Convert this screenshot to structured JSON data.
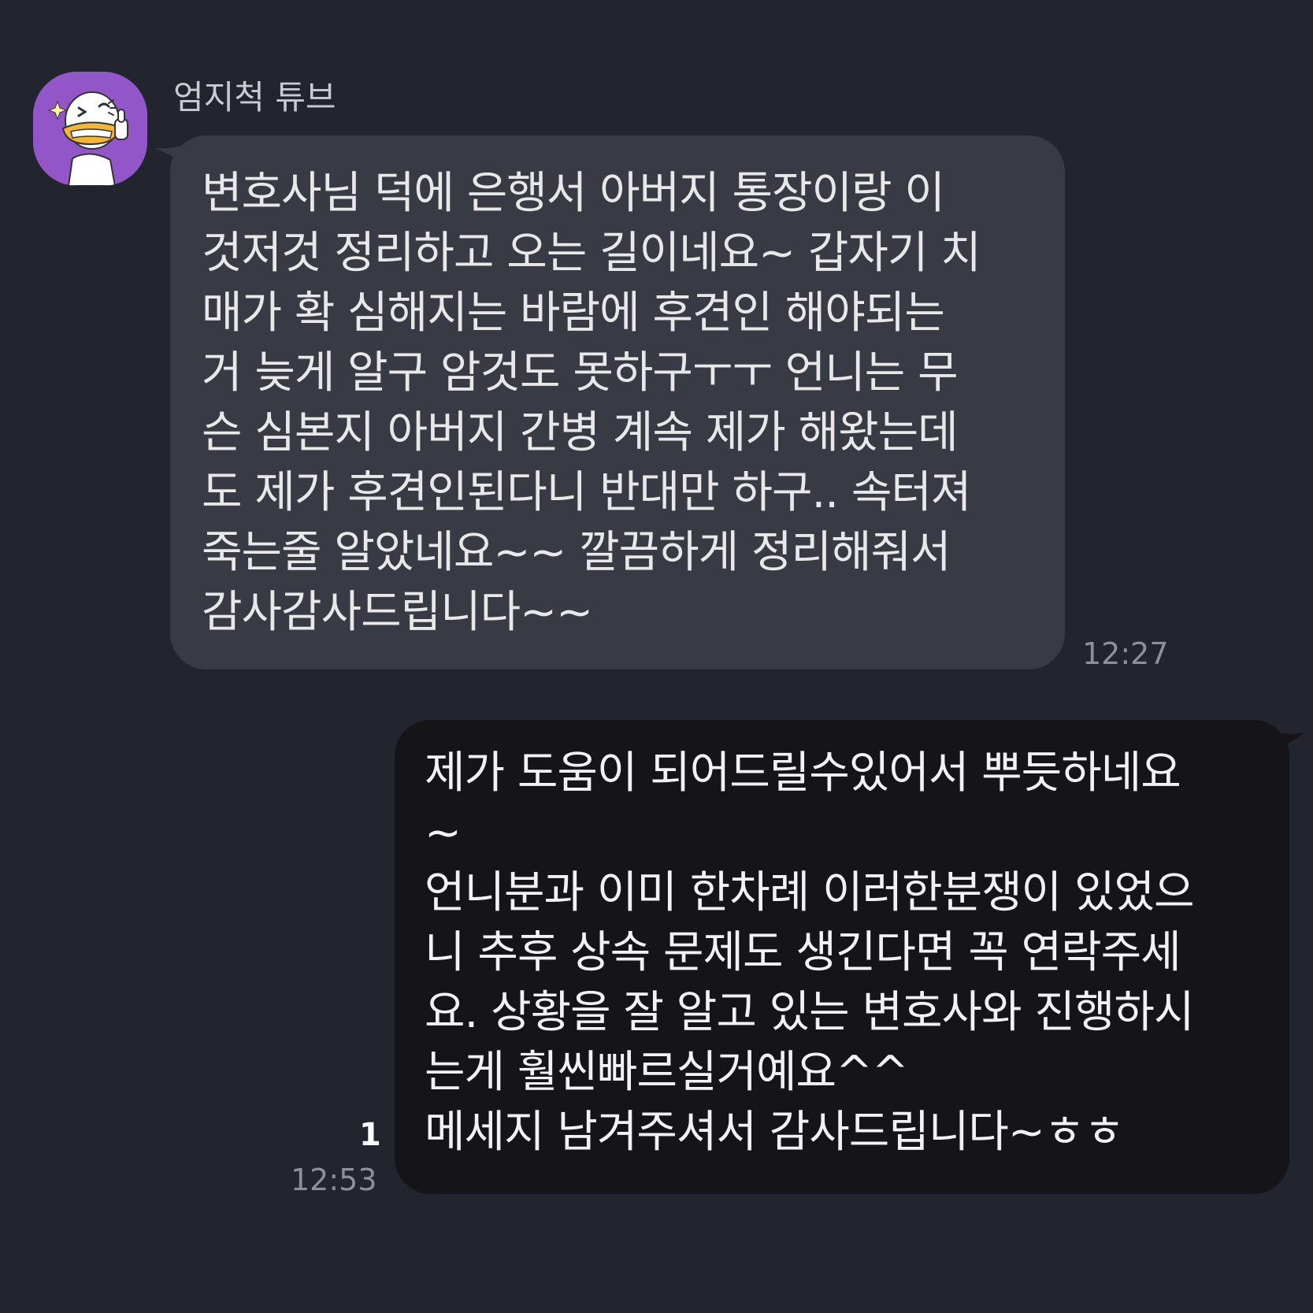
{
  "incoming": {
    "sender_name": "엄지척 튜브",
    "avatar_icon": "tube-duck-thumbs-up-icon",
    "avatar_color": "#9256c9",
    "bubble_color": "#393b44",
    "text": "변호사님 덕에 은행서 아버지 통장이랑 이\n것저것 정리하고 오는 길이네요~ 갑자기 치\n매가 확 심해지는 바람에 후견인 해야되는\n거 늦게 알구 암것도 못하구ㅜㅜ 언니는 무\n슨 심본지 아버지 간병 계속 제가 해왔는데\n도 제가 후견인된다니 반대만 하구.. 속터져\n죽는줄 알았네요~~ 깔끔하게 정리해줘서\n감사감사드립니다~~",
    "time": "12:27"
  },
  "outgoing": {
    "bubble_color": "#141419",
    "text": "제가 도움이 되어드릴수있어서 뿌듯하네요\n~\n언니분과 이미 한차례 이러한분쟁이 있었으\n니 추후 상속 문제도 생긴다면 꼭 연락주세\n요. 상황을 잘 알고 있는 변호사와 진행하시\n는게 훨씬빠르실거예요^^\n메세지 남겨주셔서 감사드립니다~ㅎㅎ",
    "unread_count": "1",
    "time": "12:53"
  }
}
